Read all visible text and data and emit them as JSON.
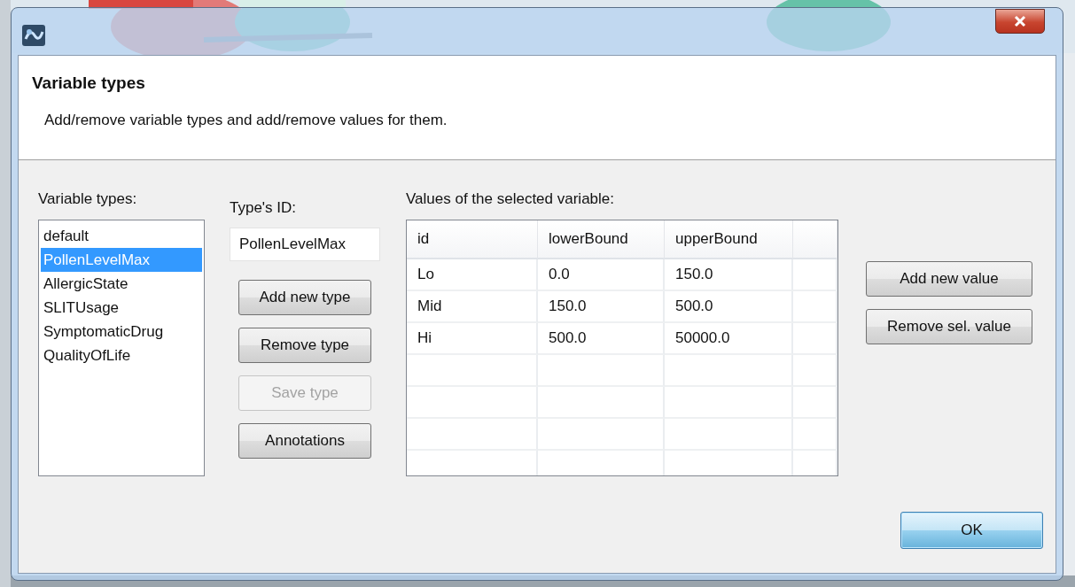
{
  "header": {
    "title": "Variable types",
    "description": "Add/remove variable types and add/remove values for them."
  },
  "variable_types": {
    "label": "Variable types:",
    "items": [
      {
        "label": "default",
        "selected": false
      },
      {
        "label": "PollenLevelMax",
        "selected": true
      },
      {
        "label": "AllergicState",
        "selected": false
      },
      {
        "label": "SLITUsage",
        "selected": false
      },
      {
        "label": "SymptomaticDrug",
        "selected": false
      },
      {
        "label": "QualityOfLife",
        "selected": false
      }
    ]
  },
  "type_id": {
    "label": "Type's ID:",
    "value": "PollenLevelMax"
  },
  "type_buttons": [
    {
      "label": "Add new type",
      "disabled": false
    },
    {
      "label": "Remove type",
      "disabled": false
    },
    {
      "label": "Save type",
      "disabled": true
    },
    {
      "label": "Annotations",
      "disabled": false
    }
  ],
  "values": {
    "label": "Values of the selected variable:",
    "columns": [
      "id",
      "lowerBound",
      "upperBound"
    ],
    "rows": [
      [
        "Lo",
        "0.0",
        "150.0"
      ],
      [
        "Mid",
        "150.0",
        "500.0"
      ],
      [
        "Hi",
        "500.0",
        "50000.0"
      ]
    ]
  },
  "value_buttons": [
    {
      "label": "Add new value",
      "disabled": false
    },
    {
      "label": "Remove sel. value",
      "disabled": false
    }
  ],
  "ok_button": {
    "label": "OK",
    "focused": true
  }
}
